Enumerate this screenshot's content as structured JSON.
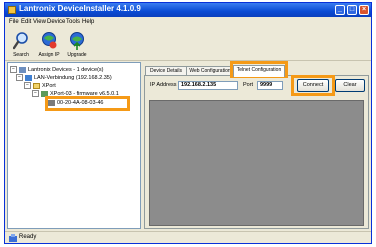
{
  "window": {
    "title": "Lantronix DeviceInstaller 4.1.0.9"
  },
  "menu": [
    "File",
    "Edit",
    "View",
    "Device",
    "Tools",
    "Help"
  ],
  "toolbar": [
    {
      "label": "Search",
      "icon": "search-icon"
    },
    {
      "label": "Assign IP",
      "icon": "assign-ip-icon"
    },
    {
      "label": "Upgrade",
      "icon": "upgrade-icon"
    }
  ],
  "tree": {
    "root": "Lantronix Devices - 1 device(s)",
    "network": "LAN-Verbindung (192.168.2.35)",
    "group": "XPort",
    "device_type": "XPort-03 - firmware v6.5.0.1",
    "device": "00-20-4A-08-03-46"
  },
  "tabs": [
    "Device Details",
    "Web Configuration",
    "Telnet Configuration"
  ],
  "active_tab": "Telnet Configuration",
  "telnet": {
    "ip_label": "IP Address",
    "ip_value": "192.168.2.135",
    "port_label": "Port",
    "port_value": "9999",
    "connect_label": "Connect",
    "clear_label": "Clear"
  },
  "status": {
    "text": "Ready"
  },
  "colors": {
    "highlight": "#f59a17",
    "titlebar": "#0a4bd4",
    "console": "#8c8c8c"
  }
}
